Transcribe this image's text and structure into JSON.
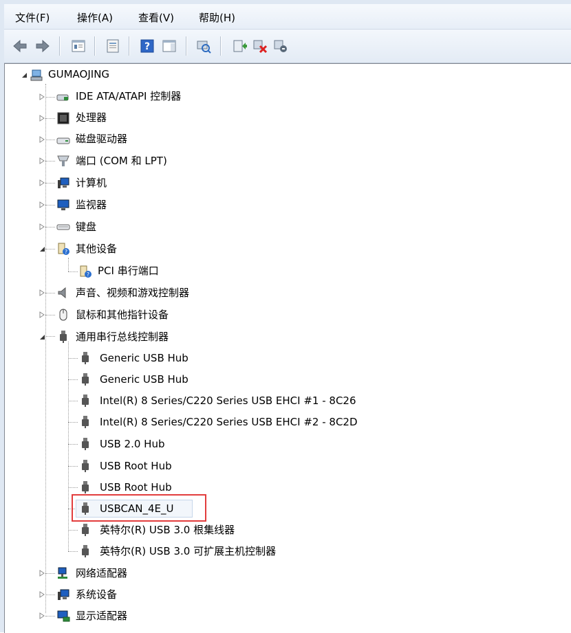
{
  "menu": {
    "file": "文件(F)",
    "action": "操作(A)",
    "view": "查看(V)",
    "help": "帮助(H)"
  },
  "toolbar": {
    "icons": [
      "back-arrow-icon",
      "forward-arrow-icon",
      "properties-console-icon",
      "print-icon",
      "help-icon",
      "action-pane-icon",
      "scan-hardware-icon",
      "update-driver-icon",
      "disable-device-icon",
      "uninstall-device-icon"
    ]
  },
  "tree": {
    "root": "GUMAOJING",
    "ide": "IDE ATA/ATAPI 控制器",
    "processor": "处理器",
    "disk": "磁盘驱动器",
    "ports": "端口 (COM 和 LPT)",
    "computer": "计算机",
    "monitor": "监视器",
    "keyboard": "键盘",
    "other": "其他设备",
    "pci_serial": "PCI 串行端口",
    "sound": "声音、视频和游戏控制器",
    "mouse": "鼠标和其他指针设备",
    "usb_controllers": "通用串行总线控制器",
    "usb_children": [
      "Generic USB Hub",
      "Generic USB Hub",
      "Intel(R) 8 Series/C220 Series USB EHCI #1 - 8C26",
      "Intel(R) 8 Series/C220 Series USB EHCI #2 - 8C2D",
      "USB 2.0 Hub",
      "USB Root Hub",
      "USB Root Hub",
      "USBCAN_4E_U",
      "英特尔(R) USB 3.0 根集线器",
      "英特尔(R) USB 3.0 可扩展主机控制器"
    ],
    "network": "网络适配器",
    "system": "系统设备",
    "display": "显示适配器"
  },
  "colors": {
    "highlight_border": "#e23c3c",
    "menubar_bg": "#f6f9fd"
  }
}
